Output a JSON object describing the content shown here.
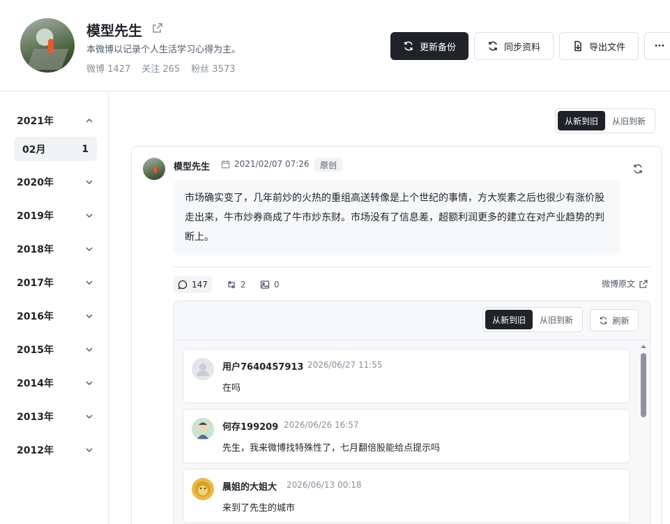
{
  "profile": {
    "name": "模型先生",
    "bio": "本微博以记录个人生活学习心得为主。",
    "weibo_count": "微博 1427",
    "following": "关注 265",
    "followers": "粉丝 3573"
  },
  "actions": {
    "update_backup": "更新备份",
    "sync_profile": "同步资料",
    "export_file": "导出文件",
    "more": "···"
  },
  "sidebar": {
    "years": [
      {
        "label": "2021年",
        "expanded": true
      },
      {
        "label": "2020年"
      },
      {
        "label": "2019年"
      },
      {
        "label": "2018年"
      },
      {
        "label": "2017年"
      },
      {
        "label": "2016年"
      },
      {
        "label": "2015年"
      },
      {
        "label": "2014年"
      },
      {
        "label": "2013年"
      },
      {
        "label": "2012年"
      }
    ],
    "month": {
      "label": "02月",
      "count": "1"
    }
  },
  "sort": {
    "newest": "从新到旧",
    "oldest": "从旧到新",
    "active": "newest"
  },
  "post": {
    "author": "模型先生",
    "date": "2021/02/07 07:26",
    "tag": "原创",
    "body": "市场确实变了，几年前炒的火热的重组高送转像是上个世纪的事情，方大炭素之后也很少有涨价股走出来，牛市炒券商成了牛市炒东财。市场没有了信息差，超额利润更多的建立在对产业趋势的判断上。",
    "comments": "147",
    "reposts": "2",
    "images": "0",
    "original_link": "微博原文"
  },
  "comments_panel": {
    "newest": "从新到旧",
    "oldest": "从旧到新",
    "refresh": "刷新",
    "items": [
      {
        "user": "用户7640457913",
        "date": "2026/06/27 11:55",
        "text": "在吗"
      },
      {
        "user": "何存199209",
        "date": "2026/06/26 16:57",
        "text": "先生，我来微博找特殊性了，七月翻倍股能给点提示吗"
      },
      {
        "user": "晨姐的大姐大",
        "date": "2026/06/13 00:18",
        "text": "来到了先生的城市"
      }
    ]
  },
  "colors": {
    "primary": "#1f2329",
    "border": "#e5e6eb",
    "muted": "#86909c",
    "panel": "#f7f8fa"
  }
}
